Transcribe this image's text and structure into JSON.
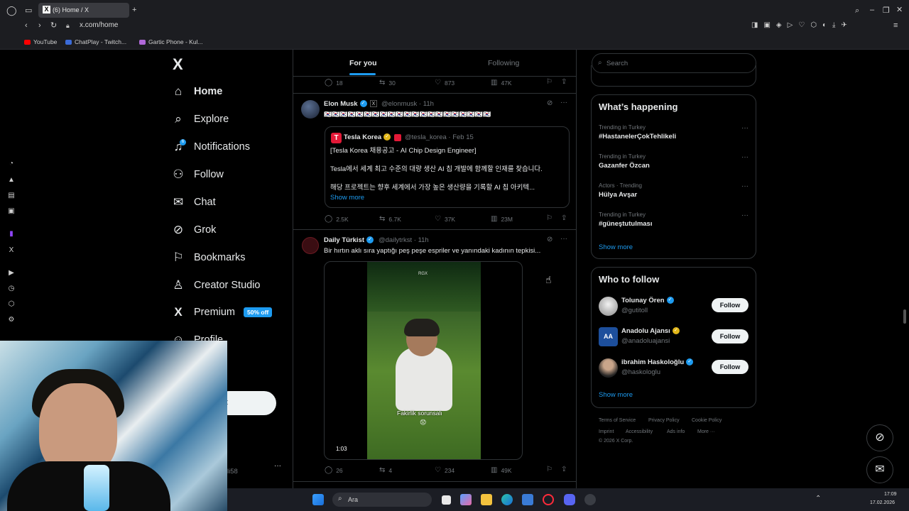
{
  "browser": {
    "tab_title": "(6) Home / X",
    "url": "x.com/home",
    "bookmarks": [
      "YouTube",
      "ChatPlay - Twitch...",
      "Gartic Phone - Kul..."
    ]
  },
  "nav": {
    "logo": "X",
    "items": [
      {
        "label": "Home",
        "icon": "home-icon"
      },
      {
        "label": "Explore",
        "icon": "search-icon"
      },
      {
        "label": "Notifications",
        "icon": "bell-icon"
      },
      {
        "label": "Follow",
        "icon": "add-user-icon"
      },
      {
        "label": "Chat",
        "icon": "mail-icon"
      },
      {
        "label": "Grok",
        "icon": "grok-icon"
      },
      {
        "label": "Bookmarks",
        "icon": "bookmark-icon"
      },
      {
        "label": "Creator Studio",
        "icon": "creator-icon"
      },
      {
        "label": "Premium",
        "icon": "x-icon"
      },
      {
        "label": "Profile",
        "icon": "profile-icon"
      }
    ],
    "premium_badge": "50% off",
    "notification_count": "6",
    "post_button_fragment": "t",
    "account_fragment": "li58",
    "account_more": "···"
  },
  "feed": {
    "tabs": [
      "For you",
      "Following"
    ],
    "top_actions": {
      "replies": "18",
      "reposts": "30",
      "likes": "873",
      "views": "47K"
    },
    "tweet1": {
      "name": "Elon Musk",
      "handle": "@elonmusk · 11h",
      "text": "🇰🇷🇰🇷🇰🇷🇰🇷🇰🇷🇰🇷🇰🇷🇰🇷🇰🇷🇰🇷🇰🇷🇰🇷🇰🇷🇰🇷🇰🇷🇰🇷🇰🇷🇰🇷🇰🇷🇰🇷🇰🇷",
      "quote": {
        "name": "Tesla Korea",
        "handle": "@tesla_korea · Feb 15",
        "line1": "[Tesla Korea 채용공고 - AI Chip Design Engineer]",
        "line2": "Tesla에서 세계 최고 수준의 대량 생산 AI 칩 개발에 함께할 인재를 찾습니다.",
        "line3": "해당 프로젝트는 향후 세계에서 가장 높은 생산량을 기록할 AI 칩 아키텍...",
        "show_more": "Show more"
      },
      "actions": {
        "replies": "2.5K",
        "reposts": "6.7K",
        "likes": "37K",
        "views": "23M"
      }
    },
    "tweet2": {
      "name": "Daily Türkist",
      "handle": "@dailytrkst · 11h",
      "text": "Bir hırtın aklı sıra yaptığı peş peşe espriler ve yanındaki kadının tepkisi...",
      "video_caption": "Fakirlik sorunsalı",
      "video_watermark": "RGX",
      "video_duration": "1:03",
      "actions": {
        "replies": "26",
        "reposts": "4",
        "likes": "234",
        "views": "49K"
      }
    }
  },
  "right": {
    "search_placeholder": "Search",
    "happening_title": "What’s happening",
    "trends": [
      {
        "meta": "Trending in Turkey",
        "name": "#HastanelerÇokTehlikeli"
      },
      {
        "meta": "Trending in Turkey",
        "name": "Gazanfer Özcan"
      },
      {
        "meta": "Actors · Trending",
        "name": "Hülya Avşar"
      },
      {
        "meta": "Trending in Turkey",
        "name": "#güneştutulması"
      }
    ],
    "show_more": "Show more",
    "who_title": "Who to follow",
    "who": [
      {
        "name": "Tolunay Ören",
        "handle": "@gutitoll",
        "button": "Follow"
      },
      {
        "name": "Anadolu Ajansı",
        "handle": "@anadoluajansi",
        "button": "Follow"
      },
      {
        "name": "ibrahim Haskoloğlu",
        "handle": "@haskologlu",
        "button": "Follow"
      }
    ],
    "footer": [
      "Terms of Service",
      "Privacy Policy",
      "Cookie Policy",
      "Imprint",
      "Accessibility",
      "Ads info",
      "More ···",
      "© 2026 X Corp."
    ]
  },
  "taskbar": {
    "search": "Ara",
    "time": "17:09",
    "date": "17.02.2026"
  }
}
